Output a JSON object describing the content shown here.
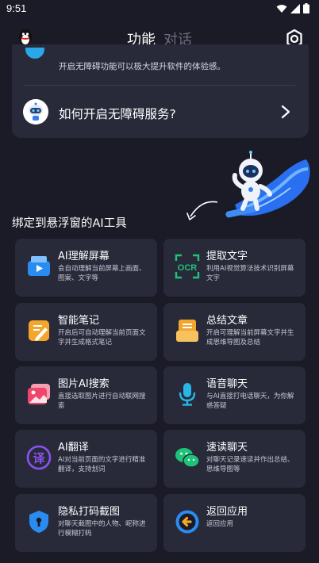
{
  "status": {
    "time": "9:51"
  },
  "header": {
    "tabs": [
      {
        "label": "功能"
      },
      {
        "label": "对话"
      }
    ]
  },
  "accessibility_card": {
    "description": "开启无障碍功能可以极大提升软件的体验感。",
    "question": "如何开启无障碍服务?"
  },
  "section": {
    "title": "绑定到悬浮窗的AI工具"
  },
  "tools": [
    {
      "title": "AI理解屏幕",
      "desc": "会自动理解当前屏幕上画面、图案、文字等",
      "icon": "screen-icon"
    },
    {
      "title": "提取文字",
      "desc": "利用AI视觉算法技术识别屏幕文字",
      "icon": "ocr-icon",
      "icon_text": "OCR"
    },
    {
      "title": "智能笔记",
      "desc": "开启后可自动理解当前页面文字并生成格式笔记",
      "icon": "note-icon"
    },
    {
      "title": "总结文章",
      "desc": "开启可理解当前屏幕文字并生成思维导图及总结",
      "icon": "summary-icon"
    },
    {
      "title": "图片AI搜索",
      "desc": "直接选取图片进行自动联网搜索",
      "icon": "image-search-icon"
    },
    {
      "title": "语音聊天",
      "desc": "与AI直接打电话聊天，为你解惑答疑",
      "icon": "microphone-icon"
    },
    {
      "title": "AI翻译",
      "desc": "AI对当前页面的文字进行精准翻译，支持划词",
      "icon": "translate-icon",
      "icon_text": "译"
    },
    {
      "title": "速读聊天",
      "desc": "对聊天记录速读并作出总结、思维导图等",
      "icon": "wechat-icon"
    },
    {
      "title": "隐私打码截图",
      "desc": "对聊天截图中的人物、昵称进行模糊打码",
      "icon": "privacy-shield-icon"
    },
    {
      "title": "返回应用",
      "desc": "返回应用",
      "icon": "back-arrow-icon"
    }
  ],
  "colors": {
    "background": "#1a1b26",
    "card": "#282a3a",
    "blue": "#2a8cf0",
    "green": "#1ec37a",
    "orange": "#f4a52c",
    "pink": "#f0456a",
    "cyan": "#29b6e6",
    "purple": "#8a52f0"
  }
}
